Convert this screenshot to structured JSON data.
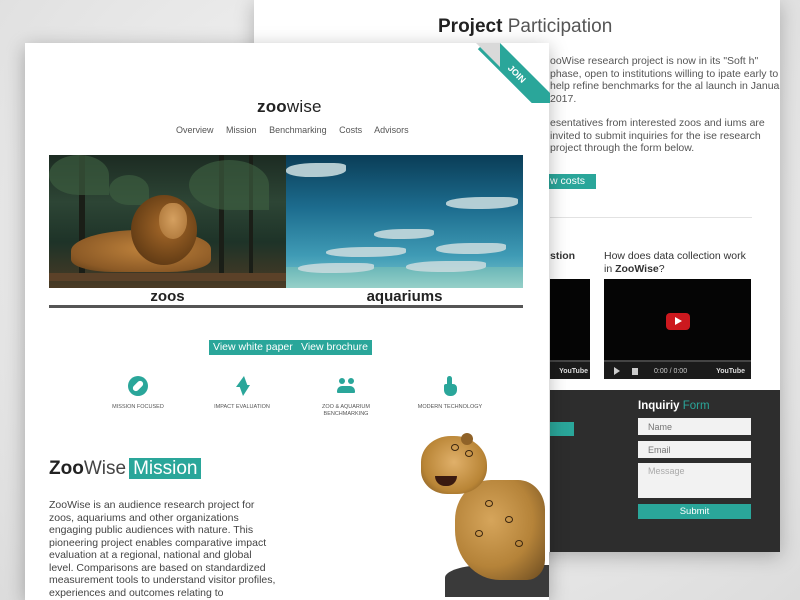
{
  "back": {
    "title_bold": "Project",
    "title_rest": " Participation",
    "para1": "ooWise research project is now in its \"Soft h\" phase, open to institutions willing to ipate early to help refine benchmarks for the al launch in January 2017.",
    "para2": "esentatives from interested zoos and iums are invited to submit inquiries for the ise research project through the form below.",
    "costs_button": "w costs",
    "video1_title": "stion",
    "video2_title_prefix": "How does data collection work in",
    "video2_title_brand": "ZooWise",
    "video2_title_suffix": "?",
    "video_time": "0:00 / 0:00",
    "youtube_label": "YouTube",
    "inquiry_title_bold": "Inquiriy",
    "inquiry_title_rest": " Form",
    "name_placeholder": "Name",
    "email_placeholder": "Email",
    "message_placeholder": "Message",
    "submit_label": "Submit"
  },
  "front": {
    "logo_bold": "zoo",
    "logo_rest": "wise",
    "nav": [
      "Overview",
      "Mission",
      "Benchmarking",
      "Costs",
      "Advisors"
    ],
    "hero_left_label": "zoos",
    "hero_right_label": "aquariums",
    "white_paper_button": "View white paper",
    "brochure_button": "View brochure",
    "features": [
      {
        "icon": "compass-icon",
        "label": "MISSION FOCUSED"
      },
      {
        "icon": "bolt-icon",
        "label": "IMPACT EVALUATION"
      },
      {
        "icon": "people-icon",
        "label": "ZOO & AQUARIUM BENCHMARKING"
      },
      {
        "icon": "touch-icon",
        "label": "MODERN TECHNOLOGY"
      }
    ],
    "mission_bold": "Zoo",
    "mission_wise": "Wise",
    "mission_tag": "Mission",
    "mission_text": "ZooWise is an audience research project for zoos, aquariums and other organizations engaging public audiences with nature. This pioneering project enables comparative impact evaluation at a regional, national and global level. Comparisons are based on standardized measurement tools to understand visitor profiles, experiences and outcomes relating to",
    "join_ribbon": "JOIN"
  },
  "colors": {
    "accent": "#2aa69a",
    "dark_panel": "#2d2d2d"
  }
}
